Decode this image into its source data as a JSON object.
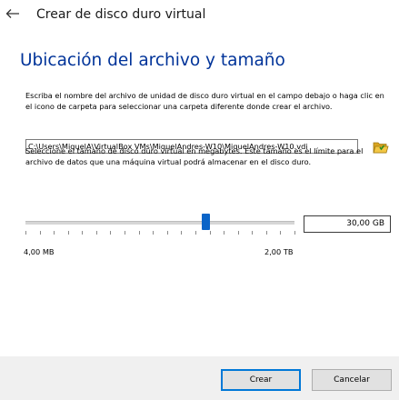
{
  "window": {
    "title": "Crear de disco duro virtual",
    "back_icon": "arrow-left-icon"
  },
  "page": {
    "heading": "Ubicación del archivo y tamaño"
  },
  "location": {
    "description": "Escriba el nombre del archivo de unidad de disco duro virtual en el campo debajo o haga clic en el icono de carpeta para seleccionar una carpeta diferente donde crear el archivo.",
    "path_value": "C:\\Users\\MiquelA\\VirtualBox VMs\\MiquelAndres-W10\\MiquelAndres-W10.vdi",
    "folder_icon": "folder-open-icon"
  },
  "size": {
    "description": "Seleccione el tamaño de disco duro virtual en megabytes. Este tamaño es el límite para el archivo de datos que una máquina virtual podrá almacenar en el disco duro.",
    "value_text": "30,00 GB",
    "slider_fraction": 0.67,
    "min_label": "4,00 MB",
    "max_label": "2,00 TB"
  },
  "buttons": {
    "create": "Crear",
    "cancel": "Cancelar"
  },
  "colors": {
    "heading": "#003399",
    "accent": "#0078d7",
    "slider_thumb": "#0a64c8",
    "footer_bg": "#f0f0f0"
  }
}
